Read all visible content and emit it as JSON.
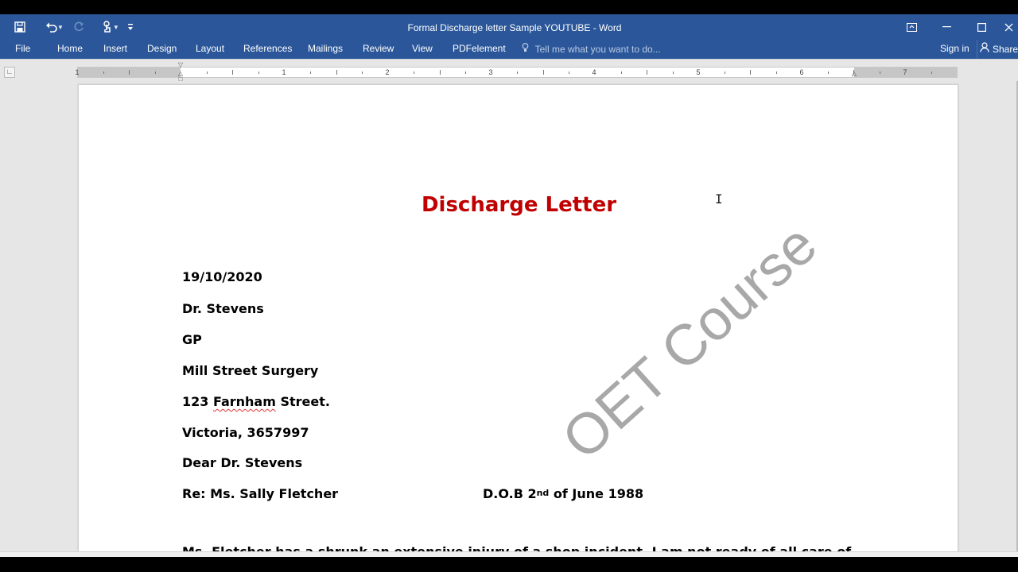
{
  "window": {
    "title": "Formal Discharge letter Sample YOUTUBE - Word",
    "controls": [
      "ribbon-display-options",
      "minimize",
      "maximize",
      "close"
    ]
  },
  "qat": {
    "icons": [
      "save-icon",
      "undo-icon",
      "redo-icon",
      "touch-mode-icon",
      "customize-qat-icon"
    ]
  },
  "ribbon": {
    "tabs": [
      "File",
      "Home",
      "Insert",
      "Design",
      "Layout",
      "References",
      "Mailings",
      "Review",
      "View",
      "PDFelement"
    ],
    "tell_me_placeholder": "Tell me what you want to do...",
    "sign_in": "Sign in",
    "share": "Share"
  },
  "ruler": {
    "numbers": [
      "1",
      "1",
      "2",
      "3",
      "4",
      "5",
      "6",
      "7"
    ]
  },
  "document": {
    "heading": "Discharge Letter",
    "lines": {
      "date": "19/10/2020",
      "recipient": "Dr. Stevens",
      "role": "GP",
      "practice": "Mill Street Surgery",
      "street_number": "123 ",
      "street_name": "Farnham",
      "street_suffix": " Street.",
      "city": "Victoria, 3657997",
      "salutation": "Dear Dr. Stevens",
      "re": "Re: Ms. Sally Fletcher",
      "dob_prefix": "D.O.B   2",
      "dob_sup": "nd",
      "dob_suffix": " of June 1988",
      "partial_next_line": "Ms. Fletcher has a shrunk an extensive injury of a shop incident. I am not ready of all care of"
    },
    "watermark": "OET Course"
  },
  "colors": {
    "titlebar": "#2b579a",
    "heading": "#c00000",
    "watermark": "#a8a8a8"
  }
}
